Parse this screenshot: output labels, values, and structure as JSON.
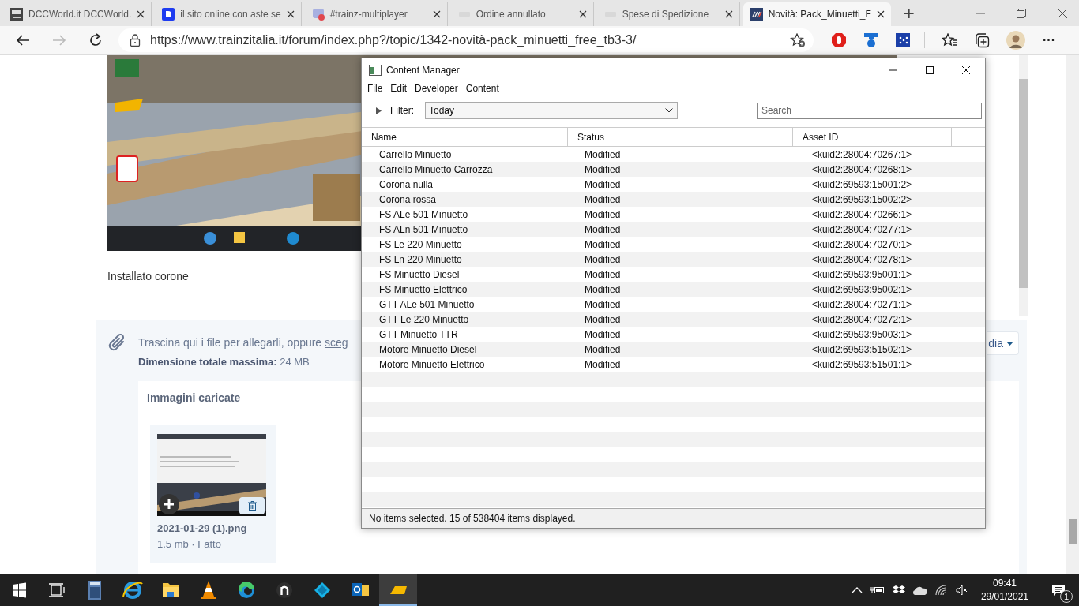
{
  "browser": {
    "tabs": [
      {
        "title": "DCCWorld.it DCCWorld.",
        "kind": "dcc",
        "selected": false
      },
      {
        "title": "il sito online con aste se",
        "kind": "blue",
        "selected": false
      },
      {
        "title": "#trainz-multiplayer",
        "kind": "chat",
        "selected": false
      },
      {
        "title": "Ordine annullato",
        "kind": "faded",
        "selected": false
      },
      {
        "title": "Spese di Spedizione",
        "kind": "faded",
        "selected": false
      },
      {
        "title": "Novità: Pack_Minuetti_F",
        "kind": "stripes",
        "selected": true
      }
    ],
    "new_tab": "+",
    "url": "https://www.trainzitalia.it/forum/index.php?/topic/1342-novità-pack_minuetti_free_tb3-3/",
    "more": "···"
  },
  "post": {
    "text": "Installato corone"
  },
  "attachments": {
    "hint": "Trascina qui i file per allegarli, oppure ",
    "hint_link": "sceg",
    "max_size": "**Dimensione totale massima:** 24 MB",
    "menu_button": "dia",
    "uploaded_title": "Immagini caricate",
    "files": [
      {
        "name": "2021-01-29 (1).png",
        "info": "1.5 mb · Fatto"
      }
    ]
  },
  "content_manager": {
    "title": "Content Manager",
    "menu": [
      "File",
      "Edit",
      "Developer",
      "Content"
    ],
    "filter_label": "Filter:",
    "filter_value": "Today",
    "search_placeholder": "Search",
    "columns": [
      "Name",
      "Status",
      "Asset ID"
    ],
    "rows": [
      {
        "name": "Carrello Minuetto",
        "status": "Modified",
        "asset_id": "<kuid2:28004:70267:1>"
      },
      {
        "name": "Carrello Minuetto Carrozza",
        "status": "Modified",
        "asset_id": "<kuid2:28004:70268:1>"
      },
      {
        "name": "Corona nulla",
        "status": "Modified",
        "asset_id": "<kuid2:69593:15001:2>"
      },
      {
        "name": "Corona rossa",
        "status": "Modified",
        "asset_id": "<kuid2:69593:15002:2>"
      },
      {
        "name": "FS ALe 501 Minuetto",
        "status": "Modified",
        "asset_id": "<kuid2:28004:70266:1>"
      },
      {
        "name": "FS ALn 501 Minuetto",
        "status": "Modified",
        "asset_id": "<kuid2:28004:70277:1>"
      },
      {
        "name": "FS Le 220 Minuetto",
        "status": "Modified",
        "asset_id": "<kuid2:28004:70270:1>"
      },
      {
        "name": "FS Ln 220 Minuetto",
        "status": "Modified",
        "asset_id": "<kuid2:28004:70278:1>"
      },
      {
        "name": "FS Minuetto Diesel",
        "status": "Modified",
        "asset_id": "<kuid2:69593:95001:1>"
      },
      {
        "name": "FS Minuetto Elettrico",
        "status": "Modified",
        "asset_id": "<kuid2:69593:95002:1>"
      },
      {
        "name": "GTT ALe 501 Minuetto",
        "status": "Modified",
        "asset_id": "<kuid2:28004:70271:1>"
      },
      {
        "name": "GTT Le 220 Minuetto",
        "status": "Modified",
        "asset_id": "<kuid2:28004:70272:1>"
      },
      {
        "name": "GTT Minuetto TTR",
        "status": "Modified",
        "asset_id": "<kuid2:69593:95003:1>"
      },
      {
        "name": "Motore Minuetto Diesel",
        "status": "Modified",
        "asset_id": "<kuid2:69593:51502:1>"
      },
      {
        "name": "Motore Minuetto Elettrico",
        "status": "Modified",
        "asset_id": "<kuid2:69593:51501:1>"
      }
    ],
    "status_bar": "No items selected. 15 of 538404 items displayed."
  },
  "taskbar": {
    "apps": [
      {
        "kind": "calculator",
        "active": false
      },
      {
        "kind": "ie",
        "active": false
      },
      {
        "kind": "folder",
        "active": false
      },
      {
        "kind": "cone",
        "active": false
      },
      {
        "kind": "edge",
        "active": false
      },
      {
        "kind": "n",
        "active": false
      },
      {
        "kind": "kodi",
        "active": false
      },
      {
        "kind": "mail",
        "active": false
      },
      {
        "kind": "trainz",
        "active": true
      }
    ],
    "time": "09:41",
    "date": "29/01/2021",
    "notifications": "1"
  }
}
